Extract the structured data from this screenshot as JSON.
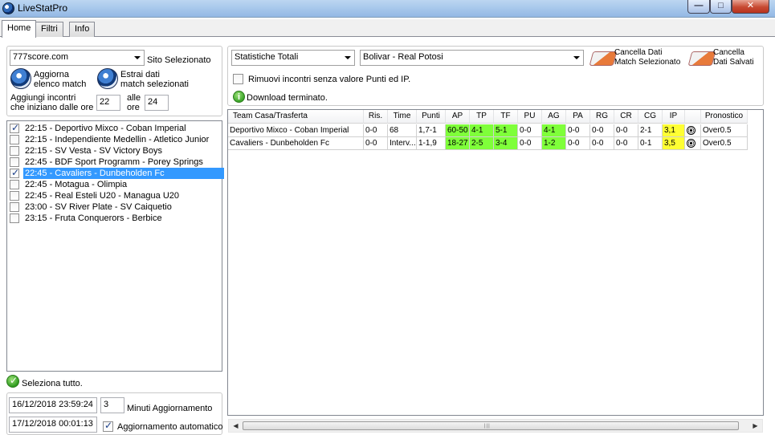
{
  "window": {
    "title": "LiveStatPro",
    "controls": {
      "minimize": "—",
      "maximize": "□",
      "close": "✕"
    }
  },
  "tabs": [
    "Home",
    "Filtri",
    "Info"
  ],
  "source": {
    "selected": "777score.com",
    "label": "Sito Selezionato"
  },
  "actions": {
    "update_list": [
      "Aggiorna",
      "elenco match"
    ],
    "extract": [
      "Estrai dati",
      "match selezionati"
    ],
    "add_matches": [
      "Aggiungi incontri",
      "che iniziano dalle ore"
    ],
    "from_hour": "22",
    "to_label": [
      "alle",
      "ore"
    ],
    "to_hour": "24"
  },
  "matches": [
    {
      "label": "22:15 - Deportivo Mixco - Coban Imperial",
      "checked": true,
      "selected": false
    },
    {
      "label": "22:15 - Independiente Medellin - Atletico Junior",
      "checked": false,
      "selected": false
    },
    {
      "label": "22:15 - SV Vesta - SV Victory Boys",
      "checked": false,
      "selected": false
    },
    {
      "label": "22:45 - BDF Sport Programm - Porey Springs",
      "checked": false,
      "selected": false
    },
    {
      "label": "22:45 - Cavaliers - Dunbeholden Fc",
      "checked": true,
      "selected": true
    },
    {
      "label": "22:45 - Motagua - Olimpia",
      "checked": false,
      "selected": false
    },
    {
      "label": "22:45 - Real Esteli U20 - Managua U20",
      "checked": false,
      "selected": false
    },
    {
      "label": "23:00 - SV River Plate - SV Caiquetio",
      "checked": false,
      "selected": false
    },
    {
      "label": "23:15 - Fruta Conquerors - Berbice",
      "checked": false,
      "selected": false
    }
  ],
  "select_all": "Seleziona tutto.",
  "update": {
    "datetime_1": "16/12/2018 23:59:24",
    "minutes": "3",
    "minutes_label": "Minuti Aggiornamento",
    "datetime_2": "17/12/2018 00:01:13",
    "auto_label": "Aggiornamento automatico",
    "auto_checked": true
  },
  "stats": {
    "view": "Statistiche Totali",
    "match": "Bolivar - Real Potosi",
    "clear_selected": [
      "Cancella Dati",
      "Match Selezionato"
    ],
    "clear_saved": [
      "Cancella",
      "Dati Salvati"
    ],
    "remove_label": "Rimuovi incontri senza valore Punti ed IP.",
    "status": "Download terminato."
  },
  "grid": {
    "columns": [
      "Team Casa/Trasferta",
      "Ris.",
      "Time",
      "Punti",
      "AP",
      "TP",
      "TF",
      "PU",
      "AG",
      "PA",
      "RG",
      "CR",
      "CG",
      "IP",
      "",
      "Pronostico"
    ],
    "rows": [
      {
        "cells": [
          "Deportivo Mixco - Coban Imperial",
          "0-0",
          "68",
          "1,7-1",
          "60-50",
          "4-1",
          "5-1",
          "0-0",
          "4-1",
          "0-0",
          "0-0",
          "0-0",
          "2-1",
          "3,1",
          "",
          "Over0.5"
        ],
        "colors": [
          "",
          "",
          "",
          "",
          "green",
          "green",
          "green",
          "",
          "green",
          "",
          "",
          "",
          "",
          "yellow",
          "",
          ""
        ]
      },
      {
        "cells": [
          "Cavaliers - Dunbeholden Fc",
          "0-0",
          "Interv...",
          "1-1,9",
          "18-27",
          "2-5",
          "3-4",
          "0-0",
          "1-2",
          "0-0",
          "0-0",
          "0-0",
          "0-1",
          "3,5",
          "",
          "Over0.5"
        ],
        "colors": [
          "",
          "",
          "",
          "",
          "green",
          "green",
          "green",
          "",
          "green",
          "",
          "",
          "",
          "",
          "yellow",
          "",
          ""
        ]
      }
    ]
  },
  "scrollbar": {
    "left": "◀",
    "right": "▶"
  },
  "colors": {
    "green": "#7fff3a",
    "yellow": "#ffff33",
    "selection": "#3399ff"
  }
}
